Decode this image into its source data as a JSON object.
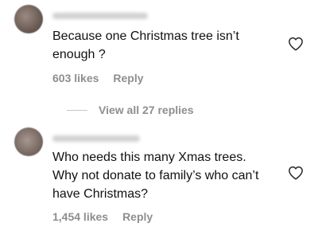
{
  "comments": [
    {
      "text": "Because one Christmas tree isn’t\nenough ?",
      "likes": "603 likes",
      "reply": "Reply"
    },
    {
      "text": "Who needs this many Xmas trees.\nWhy not donate to family’s who can’t\nhave Christmas?",
      "likes": "1,454 likes",
      "reply": "Reply"
    }
  ],
  "view_replies": {
    "label": "View all 27 replies"
  },
  "colors": {
    "text": "#111111",
    "muted": "#8e8e8e"
  },
  "icons": {
    "like": "heart-outline-icon"
  }
}
